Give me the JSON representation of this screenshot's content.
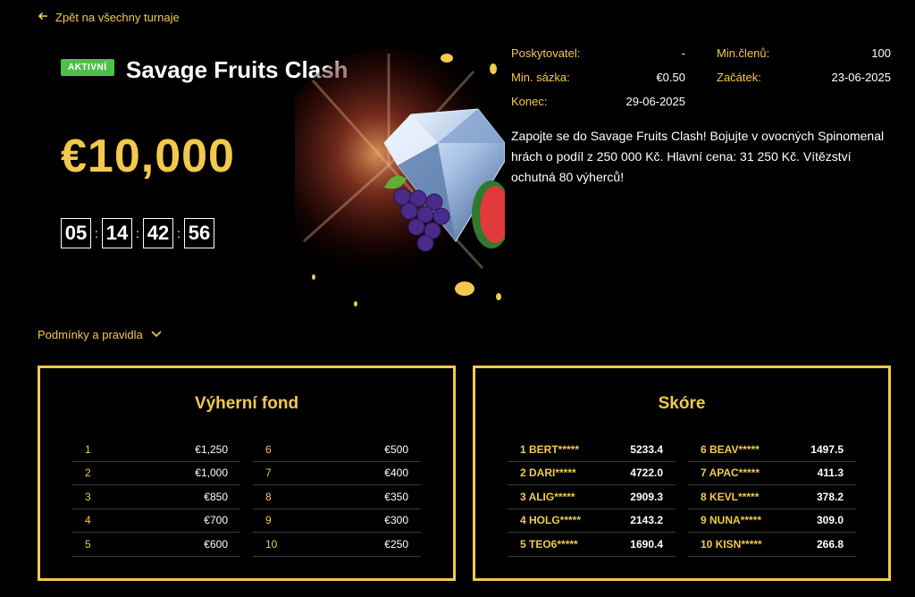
{
  "back_link": {
    "label": "Zpět na všechny turnaje"
  },
  "tournament": {
    "status": "AKTIVNÍ",
    "title": "Savage Fruits Clash",
    "prize": "€10,000",
    "countdown": [
      "05",
      "14",
      "42",
      "56"
    ]
  },
  "info": {
    "provider_label": "Poskytovatel:",
    "provider_value": "-",
    "min_members_label": "Min.členů:",
    "min_members_value": "100",
    "min_bet_label": "Min. sázka:",
    "min_bet_value": "€0.50",
    "start_label": "Začátek:",
    "start_value": "23-06-2025",
    "end_label": "Konec:",
    "end_value": "29-06-2025"
  },
  "description": "Zapojte se do Savage Fruits Clash! Bojujte v ovocných Spinomenal hrách o podíl z 250 000 Kč. Hlavní cena: 31 250 Kč. Vítězství ochutná 80 výherců!",
  "rules_toggle": {
    "label": "Podmínky a pravidla"
  },
  "prize_fund": {
    "title": "Výherní fond",
    "rows": [
      {
        "rank": "1",
        "amount": "€1,250"
      },
      {
        "rank": "2",
        "amount": "€1,000"
      },
      {
        "rank": "3",
        "amount": "€850"
      },
      {
        "rank": "4",
        "amount": "€700"
      },
      {
        "rank": "5",
        "amount": "€600"
      },
      {
        "rank": "6",
        "amount": "€500"
      },
      {
        "rank": "7",
        "amount": "€400"
      },
      {
        "rank": "8",
        "amount": "€350"
      },
      {
        "rank": "9",
        "amount": "€300"
      },
      {
        "rank": "10",
        "amount": "€250"
      }
    ]
  },
  "score_board": {
    "title": "Skóre",
    "rows": [
      {
        "name": "1 BERT*****",
        "score": "5233.4"
      },
      {
        "name": "2 DARI*****",
        "score": "4722.0"
      },
      {
        "name": "3 ALIG*****",
        "score": "2909.3"
      },
      {
        "name": "4 HOLG*****",
        "score": "2143.2"
      },
      {
        "name": "5 TEO6*****",
        "score": "1690.4"
      },
      {
        "name": "6 BEAV*****",
        "score": "1497.5"
      },
      {
        "name": "7 APAC*****",
        "score": "411.3"
      },
      {
        "name": "8 KEVL*****",
        "score": "378.2"
      },
      {
        "name": "9 NUNA*****",
        "score": "309.0"
      },
      {
        "name": "10 KISN*****",
        "score": "266.8"
      }
    ]
  },
  "colors": {
    "accent": "#f2c94c",
    "badge": "#4fbf4a",
    "background": "#000000"
  },
  "icons": {
    "back": "arrow-left-icon",
    "toggle": "chevron-down-icon"
  }
}
